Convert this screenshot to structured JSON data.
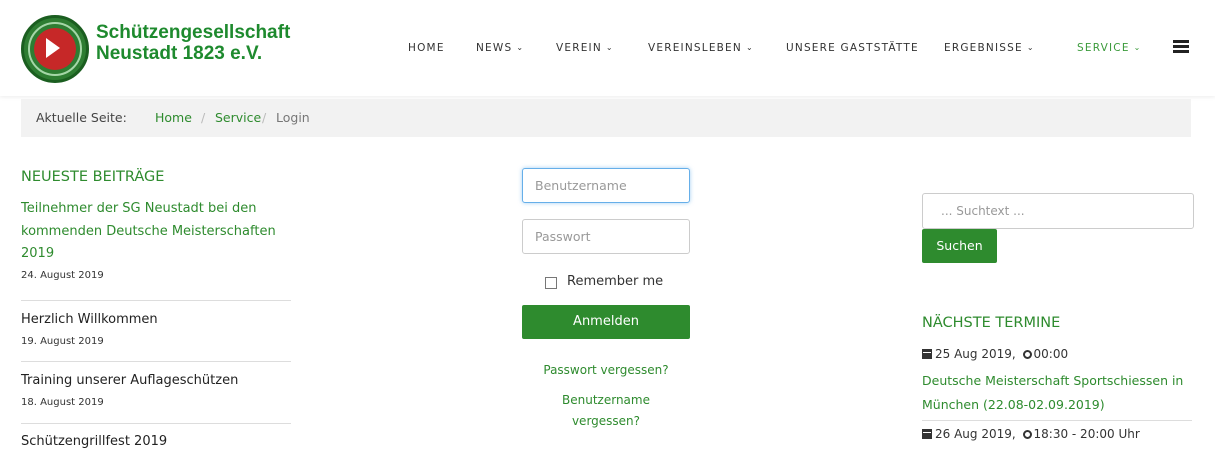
{
  "brand": {
    "line1": "Schützengesellschaft",
    "line2": "Neustadt 1823 e.V."
  },
  "nav": {
    "items": [
      {
        "label": "HOME",
        "dropdown": false
      },
      {
        "label": "NEWS",
        "dropdown": true
      },
      {
        "label": "VEREIN",
        "dropdown": true
      },
      {
        "label": "VEREINSLEBEN",
        "dropdown": true
      },
      {
        "label": "UNSERE GASTSTÄTTE",
        "dropdown": false
      },
      {
        "label": "ERGEBNISSE",
        "dropdown": true
      },
      {
        "label": "SERVICE",
        "dropdown": true,
        "active": true
      }
    ],
    "chevron": "⌄"
  },
  "breadcrumb": {
    "label": "Aktuelle Seite:",
    "items": [
      "Home",
      "Service",
      "Login"
    ],
    "separator": "/"
  },
  "latest": {
    "title": "NEUESTE BEITRÄGE",
    "posts": [
      {
        "title": "Teilnehmer der SG Neustadt bei den kommenden Deutsche Meisterschaften 2019",
        "date": "24. August 2019"
      },
      {
        "title": "Herzlich Willkommen",
        "date": "19. August 2019"
      },
      {
        "title": "Training unserer Auflageschützen",
        "date": "18. August 2019"
      },
      {
        "title": "Schützengrillfest 2019",
        "date": ""
      }
    ]
  },
  "login": {
    "username_placeholder": "Benutzername",
    "password_placeholder": "Passwort",
    "remember_label": "Remember me",
    "submit_label": "Anmelden",
    "forgot_password": "Passwort vergessen?",
    "forgot_username": "Benutzername vergessen?"
  },
  "search": {
    "placeholder": "... Suchtext ...",
    "button_label": "Suchen"
  },
  "events": {
    "title": "NÄCHSTE TERMINE",
    "items": [
      {
        "date": "25 Aug 2019,",
        "time": "00:00",
        "title": "Deutsche Meisterschaft Sportschiessen in München (22.08-02.09.2019)"
      },
      {
        "date": "26 Aug 2019,",
        "time": "18:30 - 20:00 Uhr",
        "title": ""
      }
    ]
  },
  "colors": {
    "accent": "#2e8b2e",
    "brand_text": "#1e8a2e",
    "breadcrumb_bg": "#f2f2f2"
  },
  "icons": {
    "logo": "club-emblem-icon",
    "menu": "hamburger-menu-icon",
    "calendar": "calendar-icon",
    "clock": "clock-icon",
    "dropdown": "chevron-down-icon"
  }
}
